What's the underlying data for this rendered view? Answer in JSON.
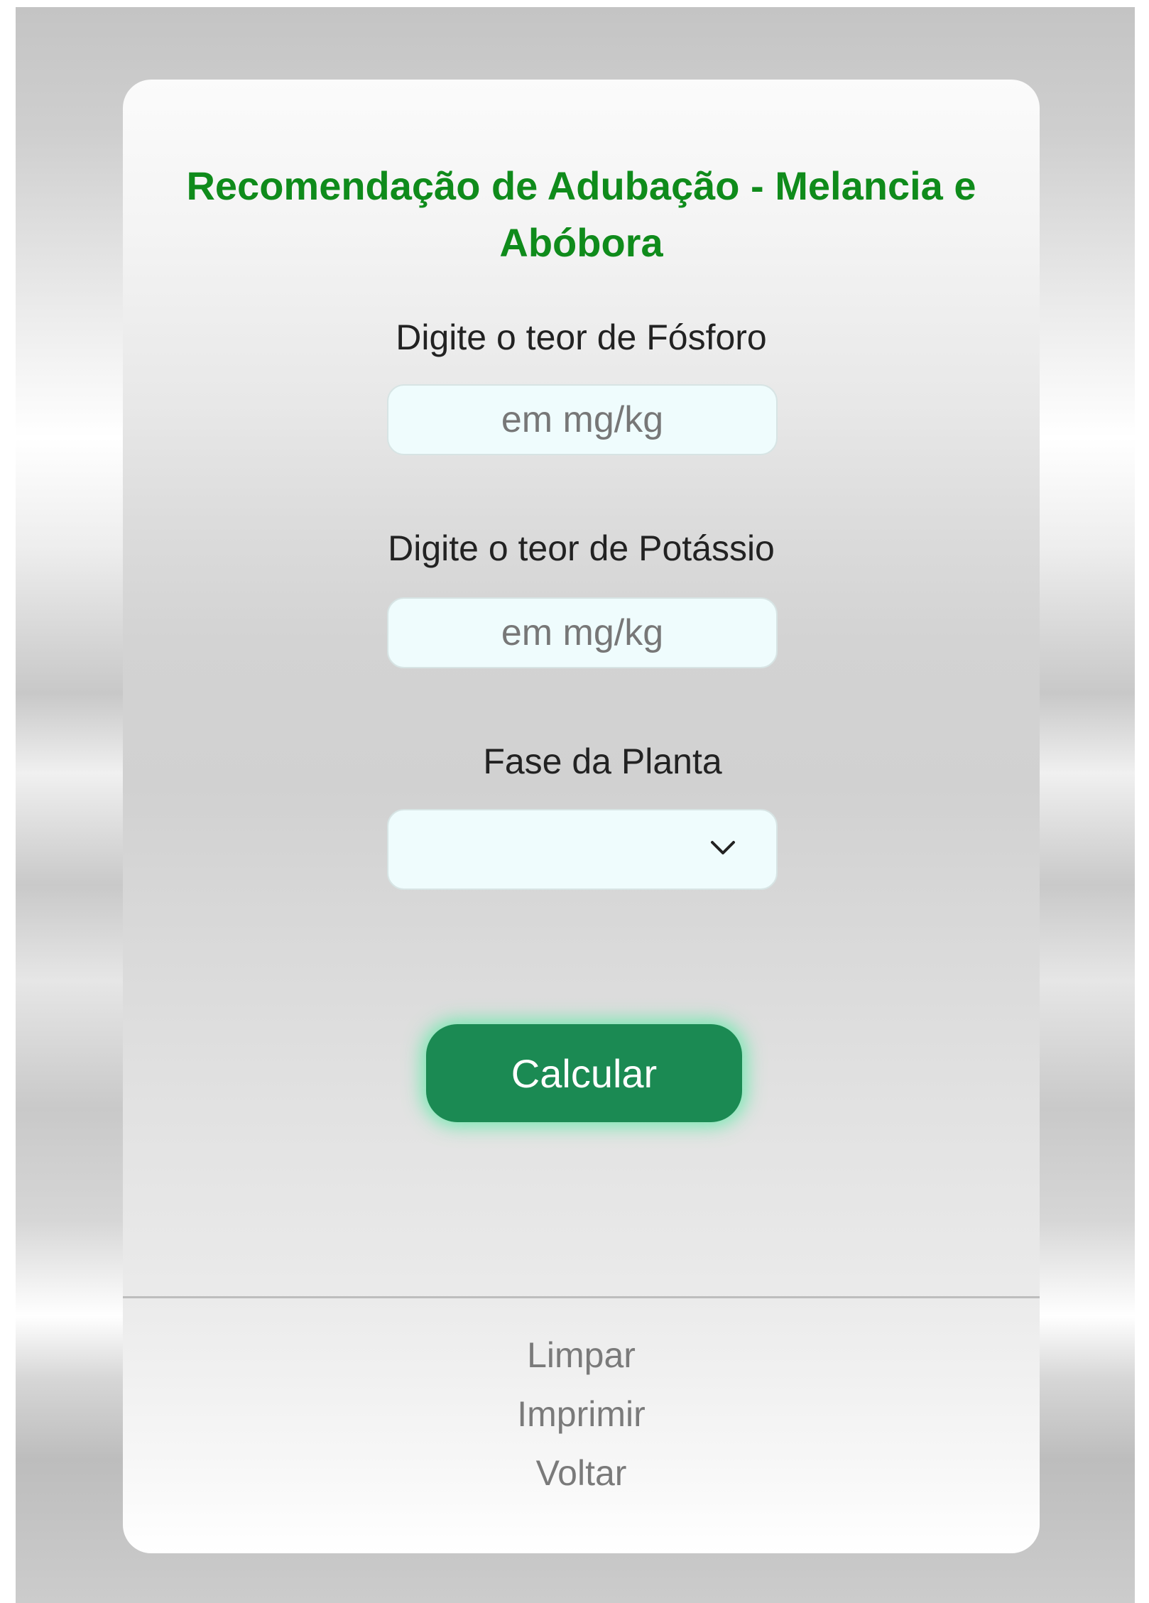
{
  "page": {
    "title": "Recomendação de Adubação - Melancia e Abóbora",
    "accent_color": "#0f8b1b",
    "button_color": "#1b8a53"
  },
  "form": {
    "phosphorus": {
      "label": "Digite o teor de Fósforo",
      "placeholder": "em mg/kg",
      "value": ""
    },
    "potassium": {
      "label": "Digite o teor de Potássio",
      "placeholder": "em mg/kg",
      "value": ""
    },
    "plant_phase": {
      "label": "Fase da Planta",
      "selected": "",
      "icon": "chevron-down-icon"
    },
    "calculate_label": "Calcular"
  },
  "footer": {
    "links": [
      "Limpar",
      "Imprimir",
      "Voltar"
    ]
  }
}
